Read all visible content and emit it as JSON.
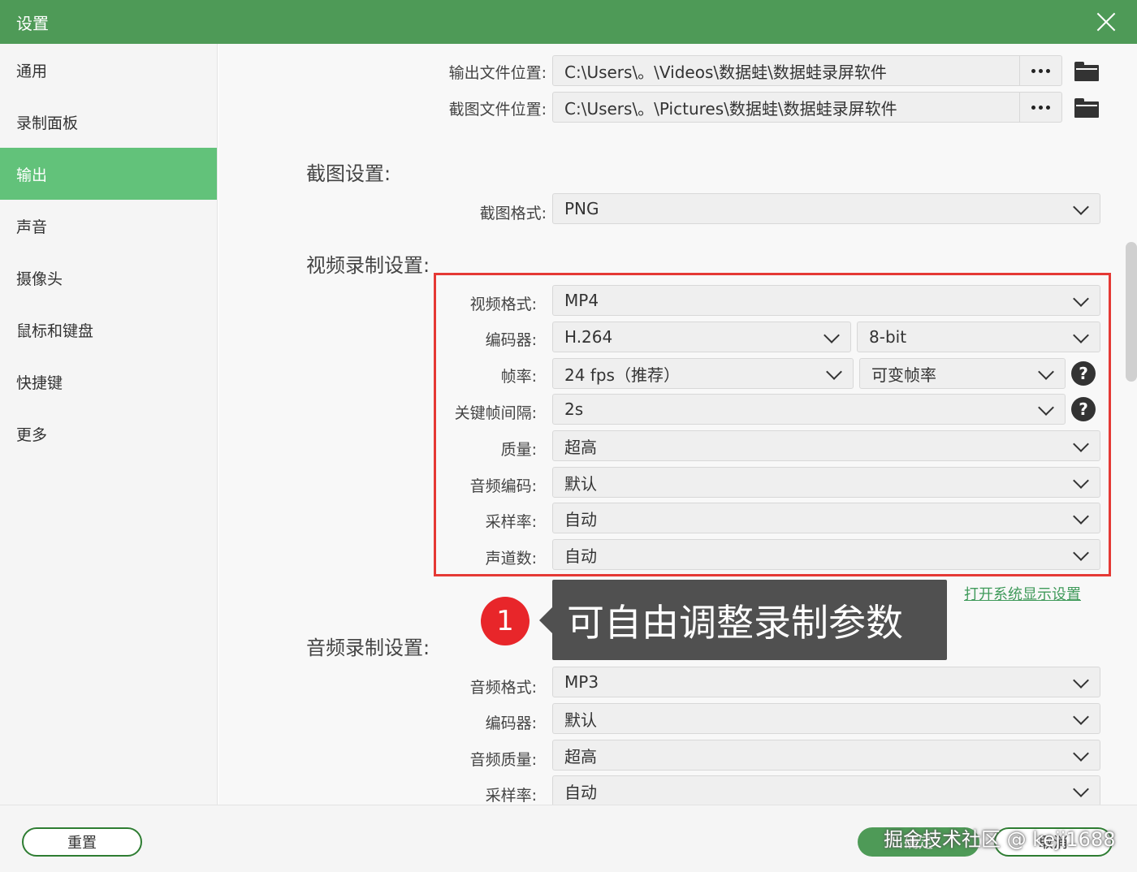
{
  "window": {
    "title": "设置"
  },
  "sidebar": {
    "items": [
      {
        "label": "通用"
      },
      {
        "label": "录制面板"
      },
      {
        "label": "输出",
        "active": true
      },
      {
        "label": "声音"
      },
      {
        "label": "摄像头"
      },
      {
        "label": "鼠标和键盘"
      },
      {
        "label": "快捷键"
      },
      {
        "label": "更多"
      }
    ]
  },
  "paths": {
    "output_label": "输出文件位置:",
    "output_value": "C:\\Users\\。\\Videos\\数据蛙\\数据蛙录屏软件",
    "screenshot_label": "截图文件位置:",
    "screenshot_value": "C:\\Users\\。\\Pictures\\数据蛙\\数据蛙录屏软件"
  },
  "screenshot_settings": {
    "title": "截图设置:",
    "format_label": "截图格式:",
    "format_value": "PNG"
  },
  "video_settings": {
    "title": "视频录制设置:",
    "format_label": "视频格式:",
    "format_value": "MP4",
    "encoder_label": "编码器:",
    "encoder_value": "H.264",
    "bitdepth_value": "8-bit",
    "framerate_label": "帧率:",
    "framerate_value": "24 fps（推荐）",
    "framerate_mode": "可变帧率",
    "keyframe_label": "关键帧间隔:",
    "keyframe_value": "2s",
    "quality_label": "质量:",
    "quality_value": "超高",
    "audio_codec_label": "音频编码:",
    "audio_codec_value": "默认",
    "samplerate_label": "采样率:",
    "samplerate_value": "自动",
    "channels_label": "声道数:",
    "channels_value": "自动",
    "display_link": "打开系统显示设置"
  },
  "callout": {
    "number": "1",
    "text": "可自由调整录制参数"
  },
  "audio_settings": {
    "title": "音频录制设置:",
    "format_label": "音频格式:",
    "format_value": "MP3",
    "encoder_label": "编码器:",
    "encoder_value": "默认",
    "quality_label": "音频质量:",
    "quality_value": "超高",
    "samplerate_label": "采样率:",
    "samplerate_value": "自动"
  },
  "footer": {
    "reset_label": "重置",
    "ok_label": "确定",
    "cancel_label": "取消",
    "watermark": "掘金技术社区 @ keji1688"
  },
  "colors": {
    "titlebar": "#4e9a57",
    "active_item": "#62c27a",
    "highlight_frame": "#e53935",
    "callout_badge": "#e8262a"
  }
}
